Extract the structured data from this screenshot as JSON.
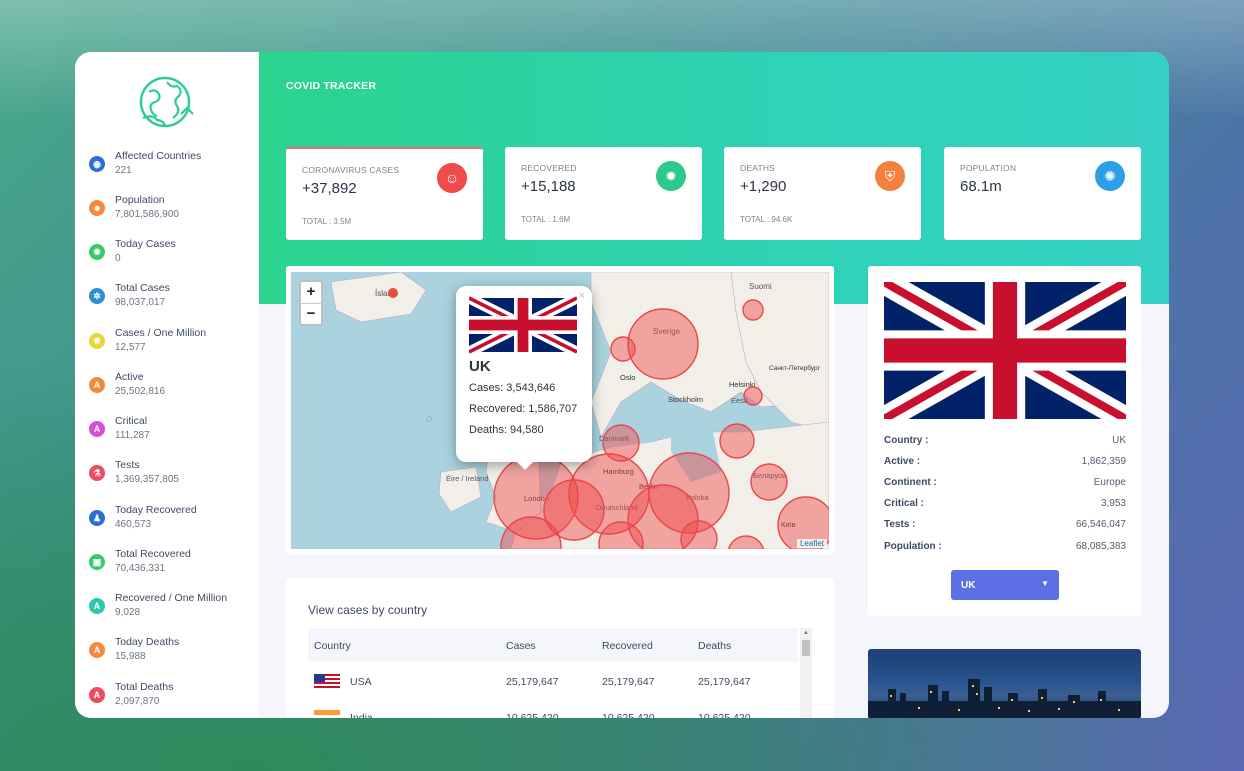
{
  "app": {
    "brand": "COVID TRACKER"
  },
  "sidebar": {
    "items": [
      {
        "label": "Affected Countries",
        "value": "221",
        "icon": "globe-icon",
        "color": "#2b6fd6"
      },
      {
        "label": "Population",
        "value": "7,801,586,900",
        "icon": "people-icon",
        "color": "#f58a3c"
      },
      {
        "label": "Today Cases",
        "value": "0",
        "icon": "virus-icon",
        "color": "#3cc96a"
      },
      {
        "label": "Total Cases",
        "value": "98,037,017",
        "icon": "virus-cluster-icon",
        "color": "#2b8fd6"
      },
      {
        "label": "Cases / One Million",
        "value": "12,577",
        "icon": "virus-icon",
        "color": "#e8d63a"
      },
      {
        "label": "Active",
        "value": "25,502,816",
        "icon": "shield-a-icon",
        "color": "#f58a3c"
      },
      {
        "label": "Critical",
        "value": "111,287",
        "icon": "shield-a-icon",
        "color": "#d64fd6"
      },
      {
        "label": "Tests",
        "value": "1,369,357,805",
        "icon": "test-icon",
        "color": "#ef4b5f"
      },
      {
        "label": "Today Recovered",
        "value": "460,573",
        "icon": "user-shield-icon",
        "color": "#2b6fd6"
      },
      {
        "label": "Total Recovered",
        "value": "70,436,331",
        "icon": "building-user-icon",
        "color": "#3cc96a"
      },
      {
        "label": "Recovered / One Million",
        "value": "9,028",
        "icon": "shield-a-icon",
        "color": "#2bc9a8"
      },
      {
        "label": "Today Deaths",
        "value": "15,988",
        "icon": "shield-a-icon",
        "color": "#f58a3c"
      },
      {
        "label": "Total Deaths",
        "value": "2,097,870",
        "icon": "shield-a-icon",
        "color": "#ef4b5f"
      }
    ]
  },
  "stats": [
    {
      "label": "CORONAVIRUS CASES",
      "value": "+37,892",
      "total": "TOTAL : 3.5M",
      "icon": "group-icon",
      "color": "#ef4b4b"
    },
    {
      "label": "RECOVERED",
      "value": "+15,188",
      "total": "TOTAL : 1.6M",
      "icon": "virus-icon",
      "color": "#2bc98e"
    },
    {
      "label": "DEATHS",
      "value": "+1,290",
      "total": "TOTAL : 94.6K",
      "icon": "shield-icon",
      "color": "#f57f3c"
    },
    {
      "label": "POPULATION",
      "value": "68.1m",
      "total": "",
      "icon": "virus-badge-icon",
      "color": "#2b9fe8"
    }
  ],
  "map": {
    "zoom_in": "+",
    "zoom_out": "−",
    "attribution": "Leaflet",
    "labels": {
      "iceland": "Ísland",
      "suomi": "Suomi",
      "sverige": "Sverige",
      "oslo": "Oslo",
      "stockholm": "Stockholm",
      "helsinki": "Helsinki",
      "spb": "Санкт-Петербург",
      "eesti": "Eesti",
      "danmark": "Danmark",
      "hamburg": "Hamburg",
      "berlin": "Berlin",
      "polska": "Polska",
      "deutschland": "Deutschland",
      "ireland": "Éire / Ireland",
      "london": "London",
      "belarus": "Беларусь",
      "kyiv": "Київ"
    },
    "popup": {
      "close": "×",
      "name": "UK",
      "cases": "Cases: 3,543,646",
      "recovered": "Recovered: 1,586,707",
      "deaths": "Deaths: 94,580"
    }
  },
  "table": {
    "title": "View cases by country",
    "headers": [
      "Country",
      "Cases",
      "Recovered",
      "Deaths"
    ],
    "rows": [
      {
        "country": "USA",
        "cases": "25,179,647",
        "recovered": "25,179,647",
        "deaths": "25,179,647"
      },
      {
        "country": "India",
        "cases": "10,625,420",
        "recovered": "10,625,420",
        "deaths": "10,625,420"
      }
    ]
  },
  "country_info": {
    "rows": [
      {
        "key": "Country :",
        "value": "UK"
      },
      {
        "key": "Active :",
        "value": "1,862,359"
      },
      {
        "key": "Continent :",
        "value": "Europe"
      },
      {
        "key": "Critical :",
        "value": "3,953"
      },
      {
        "key": "Tests :",
        "value": "66,546,047"
      },
      {
        "key": "Population :",
        "value": "68,085,383"
      }
    ],
    "select_value": "UK"
  }
}
